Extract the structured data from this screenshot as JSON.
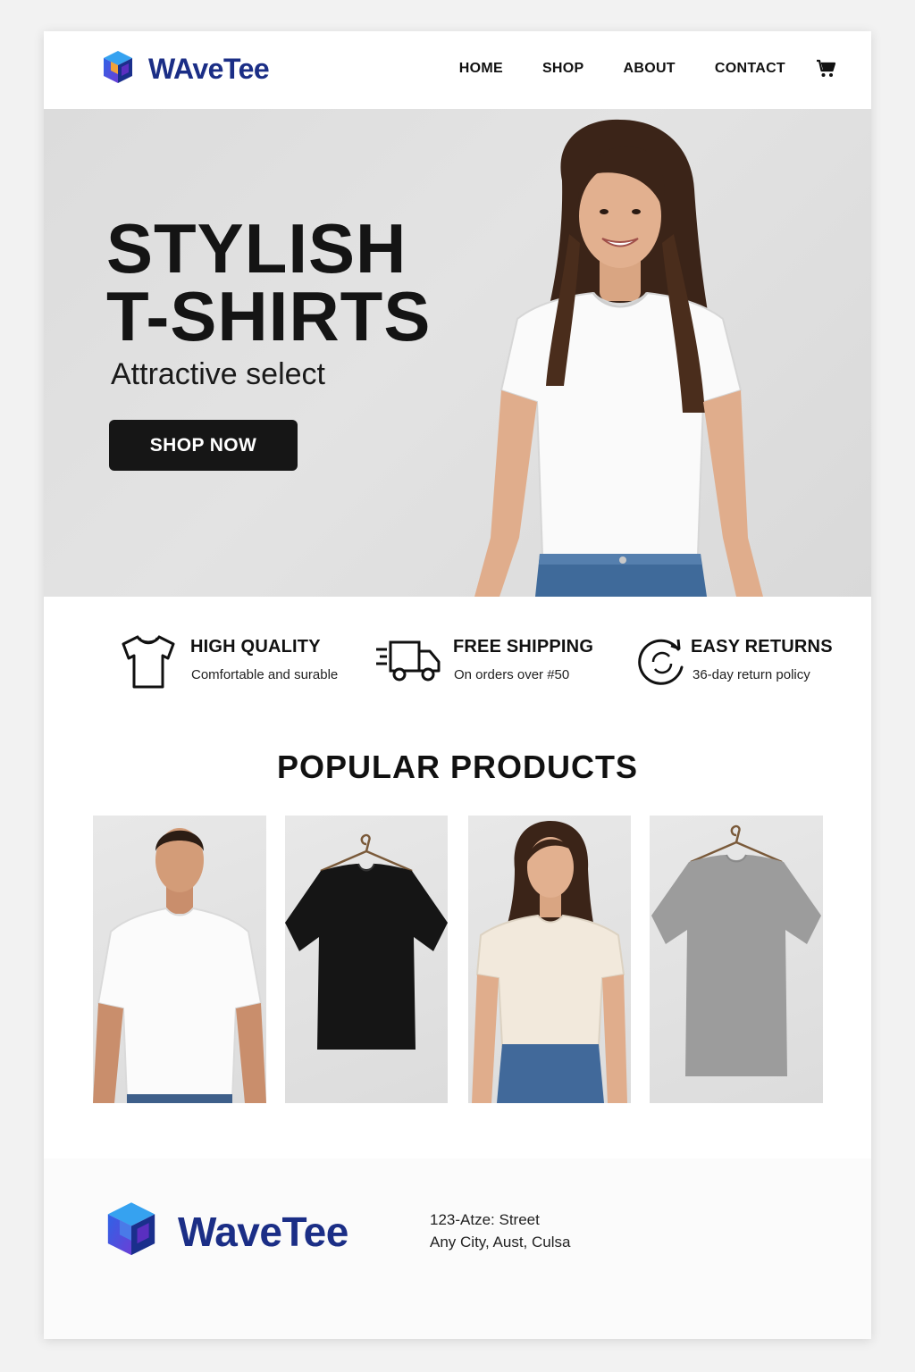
{
  "brand": {
    "name": "WAveTee",
    "footer_name": "WaveTee"
  },
  "nav": {
    "items": [
      {
        "label": "HOME"
      },
      {
        "label": "SHOP"
      },
      {
        "label": "ABOUT"
      },
      {
        "label": "CONTACT"
      }
    ],
    "cart_icon": "cart-icon"
  },
  "hero": {
    "title_line1": "STYLISH",
    "title_line2": "T-SHIRTS",
    "subtitle": "Attractive select",
    "cta": "SHOP NOW",
    "background": "#dedede"
  },
  "features": [
    {
      "icon": "tshirt-icon",
      "title": "HIGH QUALITY",
      "desc": "Comfortable and surable"
    },
    {
      "icon": "truck-icon",
      "title": "FREE SHIPPING",
      "desc": "On orders over #50"
    },
    {
      "icon": "returns-icon",
      "title": "EASY RETURNS",
      "desc": "36-day return policy"
    }
  ],
  "popular": {
    "title": "POPULAR PRODUCTS",
    "products": [
      {
        "name": "white-tshirt-man",
        "shirt_color": "#ffffff"
      },
      {
        "name": "black-tshirt-hanger",
        "shirt_color": "#111111"
      },
      {
        "name": "cream-tshirt-woman",
        "shirt_color": "#f2e9dc"
      },
      {
        "name": "grey-tshirt-hanger",
        "shirt_color": "#9a9a9a"
      }
    ]
  },
  "footer": {
    "address_line1": "123-Atze: Street",
    "address_line2": "Any City, Aust, Culsa"
  },
  "colors": {
    "brand": "#1b2e86",
    "accent": "#6a3fd6",
    "button": "#161616"
  }
}
